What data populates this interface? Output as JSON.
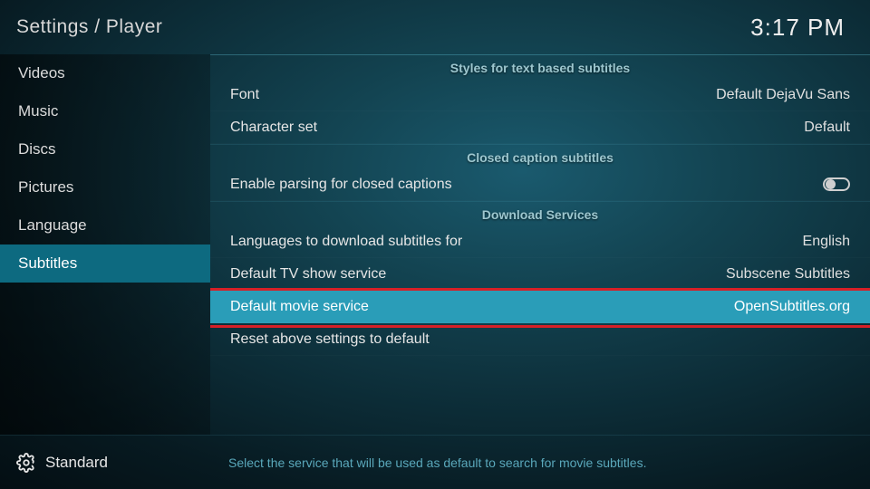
{
  "header": {
    "breadcrumb": "Settings / Player",
    "clock": "3:17 PM"
  },
  "sidebar": {
    "items": [
      {
        "label": "Videos"
      },
      {
        "label": "Music"
      },
      {
        "label": "Discs"
      },
      {
        "label": "Pictures"
      },
      {
        "label": "Language"
      },
      {
        "label": "Subtitles"
      }
    ],
    "active_index": 5
  },
  "sections": {
    "styles_header": "Styles for text based subtitles",
    "cc_header": "Closed caption subtitles",
    "dl_header": "Download Services"
  },
  "rows": {
    "font": {
      "label": "Font",
      "value": "Default DejaVu Sans"
    },
    "charset": {
      "label": "Character set",
      "value": "Default"
    },
    "enable_cc": {
      "label": "Enable parsing for closed captions"
    },
    "dl_lang": {
      "label": "Languages to download subtitles for",
      "value": "English"
    },
    "tv_service": {
      "label": "Default TV show service",
      "value": "Subscene Subtitles"
    },
    "movie_service": {
      "label": "Default movie service",
      "value": "OpenSubtitles.org"
    },
    "reset": {
      "label": "Reset above settings to default"
    }
  },
  "footer": {
    "level": "Standard",
    "help": "Select the service that will be used as default to search for movie subtitles."
  }
}
